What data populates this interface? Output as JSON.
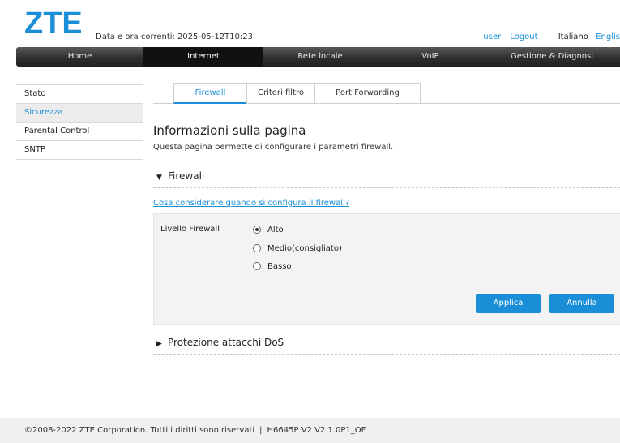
{
  "header": {
    "logo_text": "ZTE",
    "datetime_label": "Data e ora correnti:",
    "datetime_value": "2025-05-12T10:23",
    "user_label": "user",
    "logout_label": "Logout",
    "lang_current": "Italiano",
    "lang_separator": "|",
    "lang_other": "Englis"
  },
  "nav": {
    "items": [
      "Home",
      "Internet",
      "Rete locale",
      "VoIP",
      "Gestione & Diagnosi"
    ],
    "active": "Internet"
  },
  "sidebar": {
    "items": [
      "Stato",
      "Sicurezza",
      "Parental Control",
      "SNTP"
    ],
    "active": "Sicurezza"
  },
  "tabs": {
    "items": [
      "Firewall",
      "Criteri filtro",
      "Port Forwarding"
    ],
    "active": "Firewall"
  },
  "page": {
    "title": "Informazioni sulla pagina",
    "description": "Questa pagina permette di configurare i parametri firewall."
  },
  "firewall_section": {
    "title": "Firewall",
    "help_link": "Cosa considerare quando si configura il firewall?",
    "level_label": "Livello Firewall",
    "options": [
      "Alto",
      "Medio(consigliato)",
      "Basso"
    ],
    "selected": "Alto",
    "apply_label": "Applica",
    "cancel_label": "Annulla"
  },
  "dos_section": {
    "title": "Protezione attacchi DoS"
  },
  "footer": {
    "copyright": "©2008-2022 ZTE Corporation. Tutti i diritti sono riservati",
    "separator": "|",
    "version": "H6645P V2 V2.1.0P1_OF"
  },
  "colors": {
    "accent": "#1a8fd8",
    "nav_bg": "#2f2f2f",
    "logo": "#1a8fd8"
  },
  "icons": {
    "expanded": "triangle-down-icon",
    "collapsed": "triangle-right-icon"
  }
}
